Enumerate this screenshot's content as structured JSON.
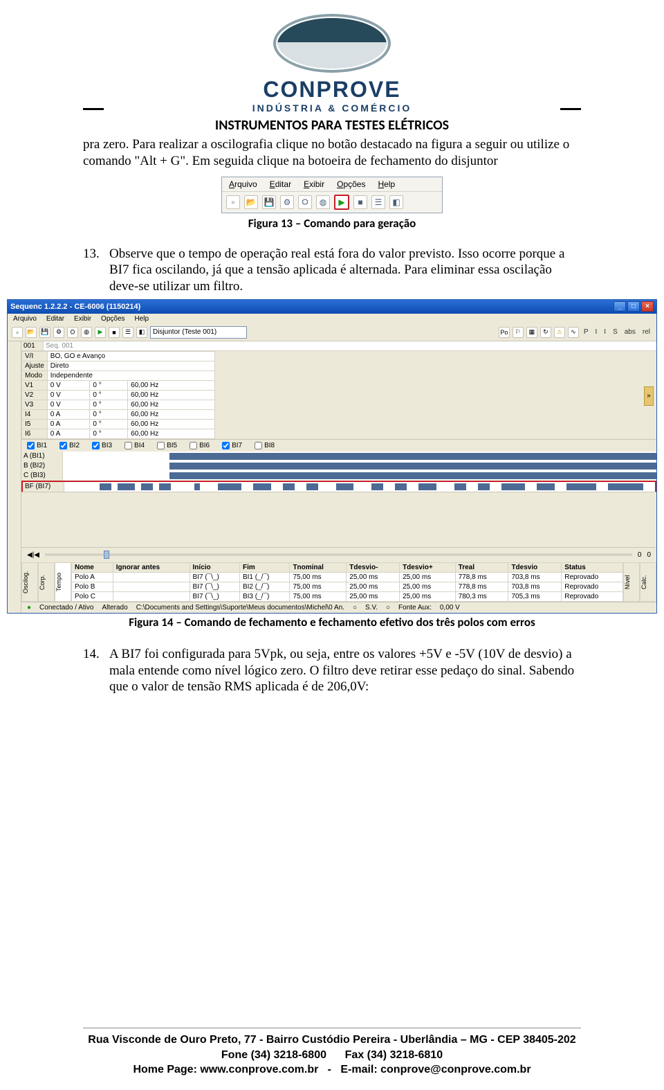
{
  "brand": {
    "name": "CONPROVE",
    "tagline": "INDÚSTRIA & COMÉRCIO",
    "subtitle": "INSTRUMENTOS PARA TESTES ELÉTRICOS"
  },
  "paragraph1": "pra zero. Para realizar a oscilografia clique no botão destacado na figura a seguir ou utilize o comando \"Alt + G\". Em seguida clique na botoeira de fechamento do disjuntor",
  "fig13": {
    "menu": [
      "Arquivo",
      "Editar",
      "Exibir",
      "Opções",
      "Help"
    ],
    "caption": "Figura 13 – Comando para geração"
  },
  "step13": {
    "num": "13.",
    "text": "Observe que o tempo de operação real está fora do valor previsto. Isso ocorre porque a BI7 fica oscilando, já que a tensão aplicada é alternada. Para eliminar essa oscilação deve-se utilizar um filtro."
  },
  "app": {
    "title": "Sequenc 1.2.2.2 - CE-6006 (1150214)",
    "menu": [
      "Arquivo",
      "Editar",
      "Exibir",
      "Opções",
      "Help"
    ],
    "toolbar": {
      "combo": "Disjuntor (Teste 001)",
      "badges": [
        "P",
        "I",
        "I",
        "S",
        "abs",
        "rel"
      ]
    },
    "seqId": "001",
    "seqName": "Seq. 001",
    "rows": [
      {
        "h": "V/I",
        "v": "BO, GO e Avanço"
      },
      {
        "h": "Ajuste",
        "v": "Direto"
      },
      {
        "h": "Modo",
        "v": "Independente"
      }
    ],
    "channels": [
      {
        "n": "V1",
        "v": "0 V",
        "a": "0 °",
        "f": "60,00 Hz"
      },
      {
        "n": "V2",
        "v": "0 V",
        "a": "0 °",
        "f": "60,00 Hz"
      },
      {
        "n": "V3",
        "v": "0 V",
        "a": "0 °",
        "f": "60,00 Hz"
      },
      {
        "n": "I4",
        "v": "0 A",
        "a": "0 °",
        "f": "60,00 Hz"
      },
      {
        "n": "I5",
        "v": "0 A",
        "a": "0 °",
        "f": "60,00 Hz"
      },
      {
        "n": "I6",
        "v": "0 A",
        "a": "0 °",
        "f": "60,00 Hz"
      }
    ],
    "bi": [
      {
        "n": "BI1",
        "c": true
      },
      {
        "n": "BI2",
        "c": true
      },
      {
        "n": "BI3",
        "c": true
      },
      {
        "n": "BI4",
        "c": false
      },
      {
        "n": "BI5",
        "c": false
      },
      {
        "n": "BI6",
        "c": false
      },
      {
        "n": "BI7",
        "c": true
      },
      {
        "n": "BI8",
        "c": false
      }
    ],
    "waves": [
      "A (BI1)",
      "B (BI2)",
      "C (BI3)",
      "BF (BI7)"
    ],
    "slider": {
      "a": "0",
      "b": "0"
    },
    "cols": [
      "Nome",
      "Ignorar antes",
      "Início",
      "Fim",
      "Tnominal",
      "Tdesvio-",
      "Tdesvio+",
      "Treal",
      "Tdesvio",
      "Status"
    ],
    "results": [
      {
        "nome": "Polo A",
        "ig": "",
        "ini": "BI7 (¯\\_)",
        "fim": "BI1 (_/¯)",
        "tn": "75,00 ms",
        "tdm": "25,00 ms",
        "tdp": "25,00 ms",
        "tr": "778,8 ms",
        "td": "703,8 ms",
        "st": "Reprovado"
      },
      {
        "nome": "Polo B",
        "ig": "",
        "ini": "BI7 (¯\\_)",
        "fim": "BI2 (_/¯)",
        "tn": "75,00 ms",
        "tdm": "25,00 ms",
        "tdp": "25,00 ms",
        "tr": "778,8 ms",
        "td": "703,8 ms",
        "st": "Reprovado"
      },
      {
        "nome": "Polo C",
        "ig": "",
        "ini": "BI7 (¯\\_)",
        "fim": "BI3 (_/¯)",
        "tn": "75,00 ms",
        "tdm": "25,00 ms",
        "tdp": "25,00 ms",
        "tr": "780,3 ms",
        "td": "705,3 ms",
        "st": "Reprovado"
      }
    ],
    "sideTabs": {
      "left1": "Oscilog.",
      "left2": "Corp.",
      "left3": "Tempo",
      "right1": "Nível",
      "right2": "Calc."
    },
    "status": {
      "conn": "Conectado / Ativo",
      "alt": "Alterado",
      "path": "C:\\Documents and Settings\\Suporte\\Meus documentos\\Michel\\0 An.",
      "sv": "S.V.",
      "aux": "Fonte Aux:",
      "auxv": "0,00 V"
    }
  },
  "fig14caption": "Figura 14 – Comando de fechamento e fechamento efetivo dos três polos com erros",
  "step14": {
    "num": "14.",
    "text": "A BI7 foi configurada para 5Vpk, ou seja, entre os valores +5V e -5V (10V de desvio) a mala entende como nível lógico zero. O filtro deve retirar esse pedaço do sinal. Sabendo que o valor de tensão RMS aplicada é de 206,0V:"
  },
  "footer": {
    "l1": "Rua Visconde de Ouro Preto, 77 - Bairro Custódio Pereira - Uberlândia – MG - CEP 38405-202",
    "l2a": "Fone (34) 3218-6800",
    "l2b": "Fax (34) 3218-6810",
    "l3a": "Home Page: www.conprove.com.br",
    "l3b": "E-mail: conprove@conprove.com.br"
  }
}
